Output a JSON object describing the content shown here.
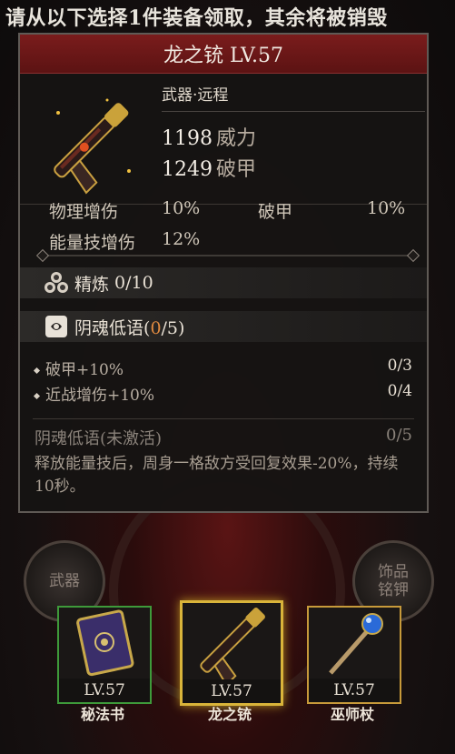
{
  "header": {
    "instruction": "请从以下选择1件装备领取，其余将被销毁"
  },
  "item": {
    "title": "龙之铳 LV.57",
    "subtype": "武器·远程",
    "stats": [
      {
        "value": "1198",
        "label": "威力"
      },
      {
        "value": "1249",
        "label": "破甲"
      }
    ],
    "bonuses": {
      "phys_label": "物理增伤",
      "phys_value": "10%",
      "armor_label": "破甲",
      "armor_value": "10%",
      "skill_label": "能量技增伤",
      "skill_value": "12%"
    },
    "refine": {
      "label": "精炼",
      "value": "0/10"
    },
    "set": {
      "name": "阴魂低语",
      "open": "(",
      "current": "0",
      "total": "/5)",
      "attributes": [
        {
          "label": "破甲+10%",
          "progress": "0/3"
        },
        {
          "label": "近战增伤+10%",
          "progress": "0/4"
        }
      ],
      "effect_title": "阴魂低语(未激活)",
      "effect_count": "0/5",
      "effect_desc": "释放能量技后，周身一格敌方受回复效果-20%，持续10秒。"
    }
  },
  "background_buttons": {
    "left": "武器",
    "right": "饰品铭钾"
  },
  "choices": [
    {
      "level": "LV.57",
      "name": "秘法书",
      "border_color": "#3e9a3a"
    },
    {
      "level": "LV.57",
      "name": "龙之铳",
      "border_color": "#d9b43a"
    },
    {
      "level": "LV.57",
      "name": "巫师杖",
      "border_color": "#c79a3a"
    }
  ]
}
